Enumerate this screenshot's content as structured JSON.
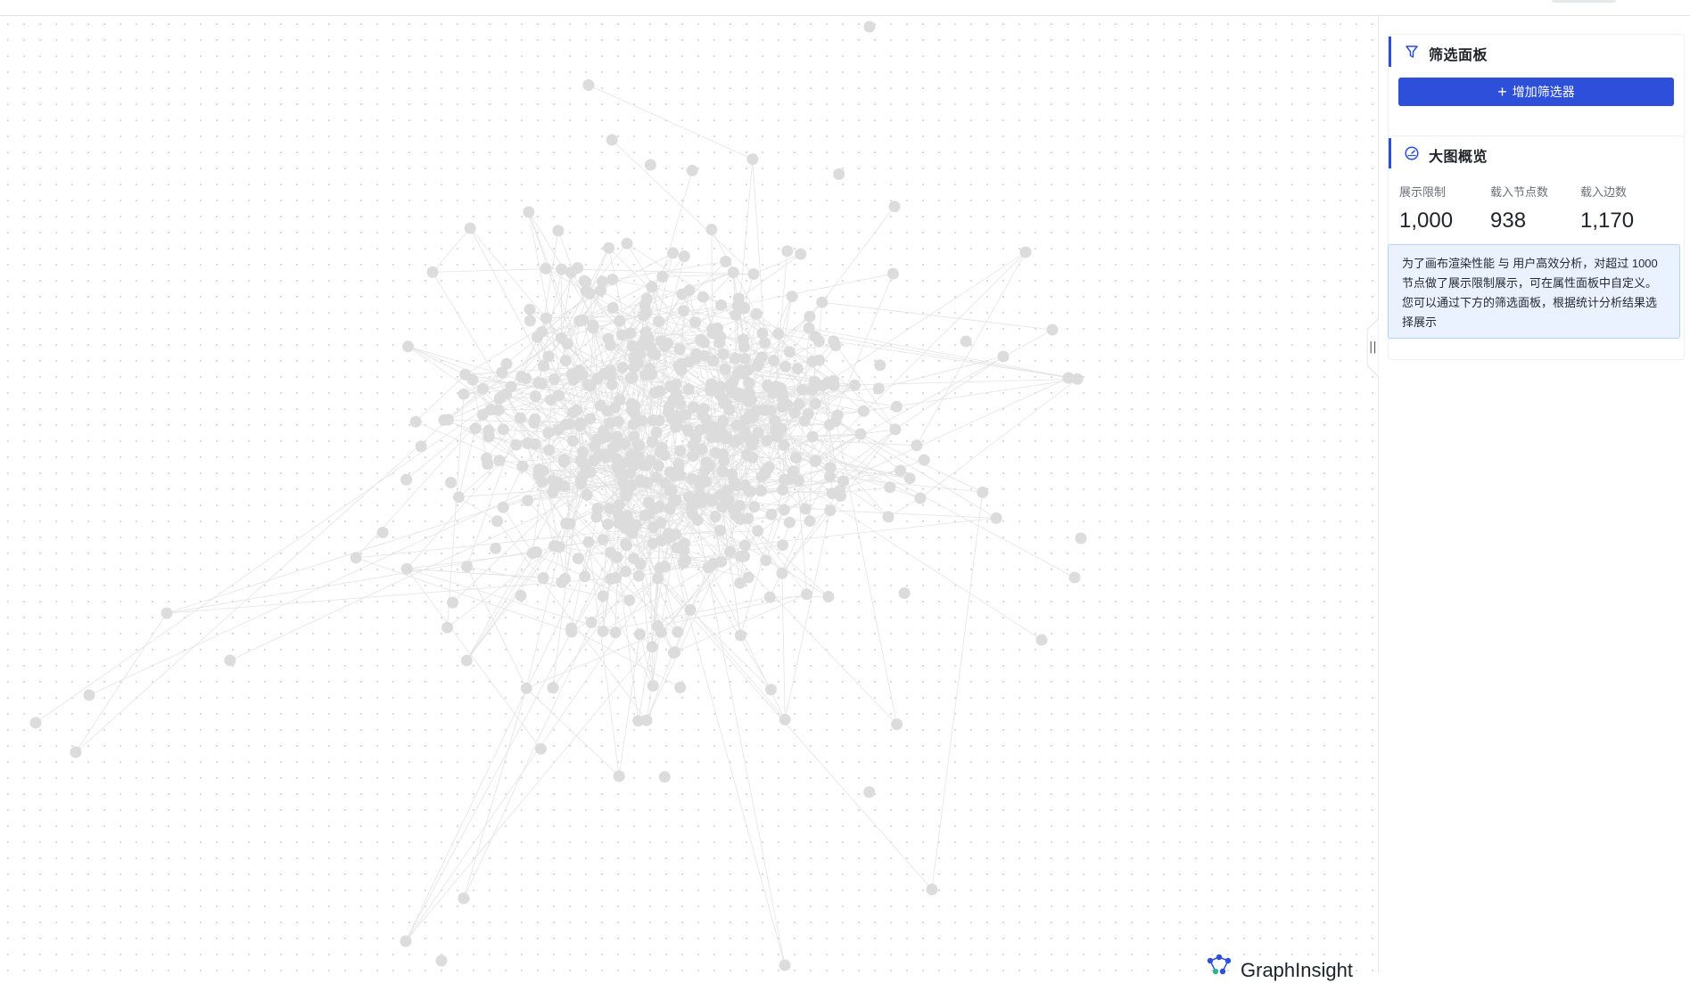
{
  "filter_panel": {
    "title": "筛选面板",
    "icon": "filter-icon",
    "add_filter_label": "增加筛选器"
  },
  "overview_panel": {
    "title": "大图概览",
    "icon": "dashboard-icon",
    "stats": [
      {
        "label": "展示限制",
        "value": "1,000"
      },
      {
        "label": "载入节点数",
        "value": "938"
      },
      {
        "label": "载入边数",
        "value": "1,170"
      }
    ],
    "notice": "为了画布渲染性能 与 用户高效分析，对超过 1000 节点做了展示限制展示，可在属性面板中自定义。您可以通过下方的筛选面板，根据统计分析结果选择展示"
  },
  "branding": {
    "logo_text": "GraphInsight"
  },
  "graph": {
    "node_color": "#dcdcdc",
    "edge_color": "#e4e4e4",
    "accent_color": "#2e4fd9"
  }
}
